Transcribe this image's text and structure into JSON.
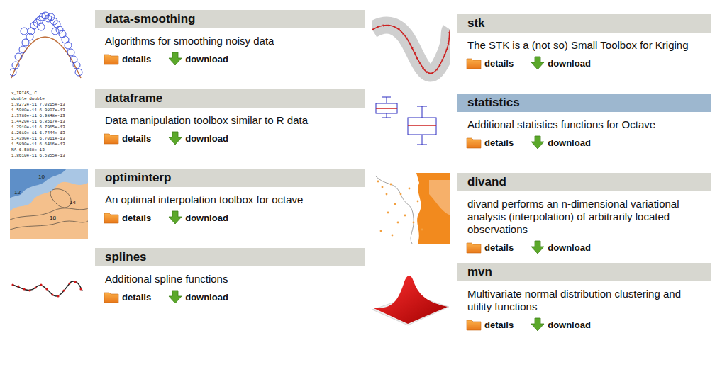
{
  "columns": [
    {
      "packages": [
        {
          "title": "data-smoothing",
          "description": "Algorithms for smoothing noisy data",
          "highlighted": false,
          "thumb": {
            "kind": "scatter-fit"
          },
          "links": [
            {
              "label": "details",
              "kind": "details"
            },
            {
              "label": "download",
              "kind": "download"
            }
          ]
        },
        {
          "title": "dataframe",
          "description": "Data manipulation toolbox similar to R data",
          "highlighted": false,
          "thumb": {
            "kind": "table-text",
            "lines": [
              "   x_IBIAS_          C",
              "     double     double",
              " 1.8272e-11 7.0215e-13",
              " 1.5980e-11 6.9807e-13",
              " 1.3780e-11 6.9848e-13",
              " 1.4420e-11 6.8517e-13",
              " 1.2910e-11 6.7965e-13",
              " 1.2610e-11 6.7444e-13",
              " 1.4390e-11 6.7011e-13",
              " 1.5890e-11 6.6416e-13",
              "         NA 6.5858e-13",
              " 1.8610e-11 6.5355e-13"
            ]
          },
          "links": [
            {
              "label": "details",
              "kind": "details"
            },
            {
              "label": "download",
              "kind": "download"
            }
          ]
        },
        {
          "title": "optiminterp",
          "description": "An optimal interpolation toolbox for octave",
          "highlighted": false,
          "thumb": {
            "kind": "contour",
            "labels": [
              "10",
              "12",
              "14",
              "18"
            ]
          },
          "links": [
            {
              "label": "details",
              "kind": "details"
            },
            {
              "label": "download",
              "kind": "download"
            }
          ]
        },
        {
          "title": "splines",
          "description": "Additional spline functions",
          "highlighted": false,
          "thumb": {
            "kind": "spline"
          },
          "links": [
            {
              "label": "details",
              "kind": "details"
            },
            {
              "label": "download",
              "kind": "download"
            }
          ]
        }
      ]
    },
    {
      "packages": [
        {
          "title": "stk",
          "description": "The STK is a (not so) Small Toolbox for Kriging",
          "highlighted": false,
          "thumb": {
            "kind": "band"
          },
          "links": [
            {
              "label": "details",
              "kind": "details"
            },
            {
              "label": "download",
              "kind": "download"
            }
          ]
        },
        {
          "title": "statistics",
          "description": "Additional statistics functions for Octave",
          "highlighted": true,
          "thumb": {
            "kind": "boxplot"
          },
          "links": [
            {
              "label": "details",
              "kind": "details"
            },
            {
              "label": "download",
              "kind": "download"
            }
          ]
        },
        {
          "title": "divand",
          "description": "divand performs an n-dimensional variational analysis (interpolation) of arbitrarily located observations",
          "highlighted": false,
          "thumb": {
            "kind": "map"
          },
          "links": [
            {
              "label": "details",
              "kind": "details"
            },
            {
              "label": "download",
              "kind": "download"
            }
          ]
        },
        {
          "title": "mvn",
          "description": "Multivariate normal distribution clustering and utility functions",
          "highlighted": false,
          "thumb": {
            "kind": "surface"
          },
          "links": [
            {
              "label": "details",
              "kind": "details"
            },
            {
              "label": "download",
              "kind": "download"
            }
          ]
        }
      ]
    }
  ]
}
